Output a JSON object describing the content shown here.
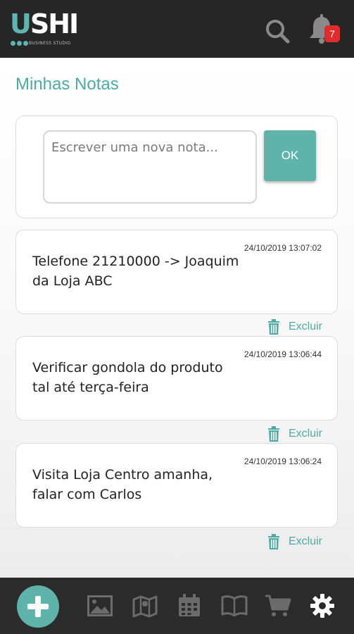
{
  "app": {
    "logo_text": "USHI",
    "logo_subtitle": "BUSINESS STUDIO",
    "notification_count": "7"
  },
  "page": {
    "title": "Minhas Notas"
  },
  "new_note": {
    "placeholder": "Escrever uma nova nota...",
    "value": "",
    "submit_label": "OK"
  },
  "notes": [
    {
      "date": "24/10/2019 13:07:02",
      "text": "Telefone 21210000 -> Joaquim da Loja ABC",
      "delete_label": "Excluir"
    },
    {
      "date": "24/10/2019 13:06:44",
      "text": "Verificar gondola do produto tal até terça-feira",
      "delete_label": "Excluir"
    },
    {
      "date": "24/10/2019 13:06:24",
      "text": "Visita Loja Centro amanha, falar com Carlos",
      "delete_label": "Excluir"
    }
  ],
  "bottom_nav": {
    "items": [
      "add-icon",
      "image-icon",
      "map-icon",
      "calendar-icon",
      "book-icon",
      "cart-icon",
      "gear-icon"
    ]
  },
  "colors": {
    "accent": "#5fb3ab",
    "title": "#4fa9a5",
    "topbar": "#262626",
    "badge": "#e02b2b"
  }
}
